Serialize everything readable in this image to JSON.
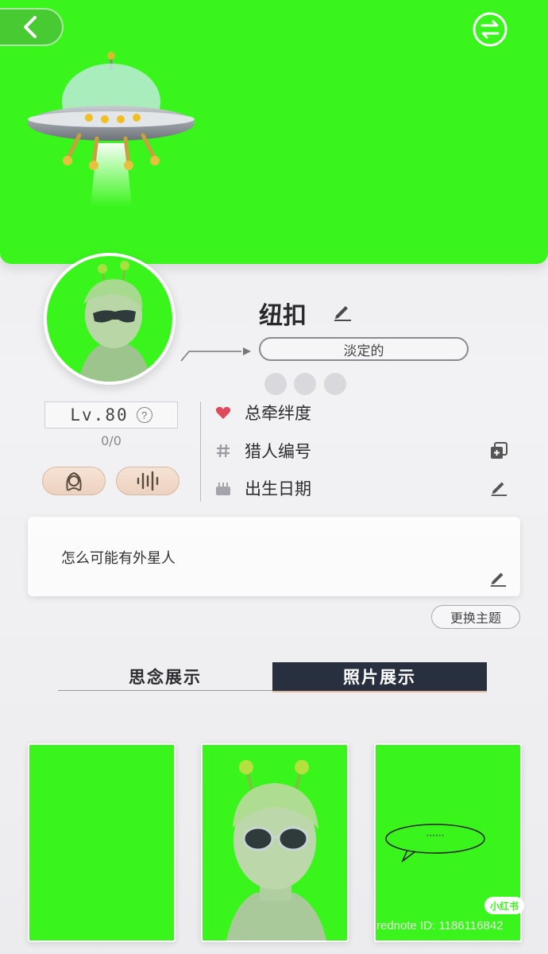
{
  "profile": {
    "nickname": "纽扣",
    "mood": "淡定的",
    "level": "Lv.80",
    "level_help": "?",
    "level_count": "0/0",
    "signature": "怎么可能有外星人"
  },
  "info": {
    "bond_label": "总牵绊度",
    "hunter_id_label": "猎人编号",
    "birthday_label": "出生日期"
  },
  "actions": {
    "change_theme": "更换主题"
  },
  "tabs": [
    {
      "label": "思念展示",
      "active": false
    },
    {
      "label": "照片展示",
      "active": true
    }
  ],
  "photos": [
    {
      "kind": "blank"
    },
    {
      "kind": "character"
    },
    {
      "kind": "speech-bubble",
      "bubble_text": "······"
    }
  ],
  "footer": {
    "badge": "小红书",
    "watermark": "rednote ID: 1186116842"
  },
  "colors": {
    "screen_green": "#3af51c",
    "active_tab_bg": "#283040",
    "heart": "#e0495b",
    "pill_bg": "#f1dbcb"
  },
  "icons": [
    "back-icon",
    "swap-icon",
    "ufo-icon",
    "pencil-icon",
    "heart-icon",
    "hash-icon",
    "cake-icon",
    "copy-icon",
    "female-avatar-icon",
    "voice-wave-icon"
  ]
}
